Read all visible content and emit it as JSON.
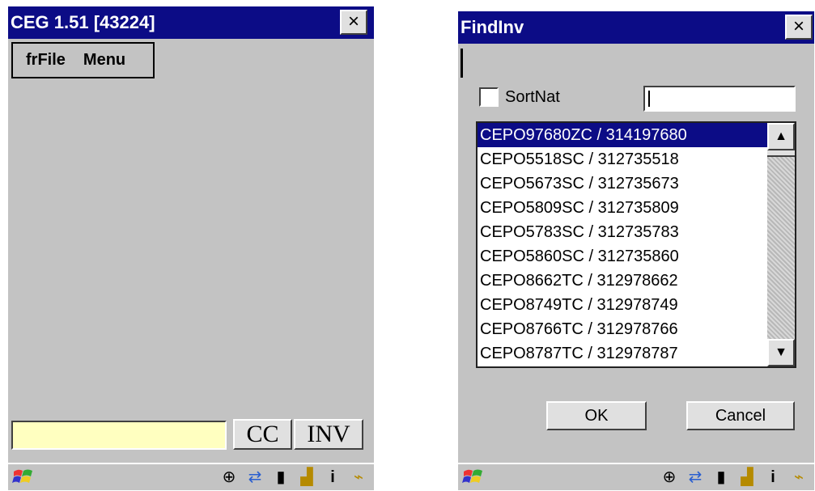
{
  "left_window": {
    "title": "CEG 1.51 [43224]",
    "close_label": "×",
    "menu": [
      "frFile",
      "Menu"
    ],
    "input_value": "",
    "buttons": {
      "cc": "CC",
      "inv": "INV"
    }
  },
  "right_window": {
    "title": "FindInv",
    "close_label": "×",
    "top_input_value": "",
    "checkbox_label": "SortNat",
    "checkbox_checked": false,
    "search_value": "",
    "list_items": [
      "CEPO97680ZC / 314197680",
      "CEPO5518SC / 312735518",
      "CEPO5673SC / 312735673",
      "CEPO5809SC / 312735809",
      "CEPO5783SC / 312735783",
      "CEPO5860SC / 312735860",
      "CEPO8662TC / 312978662",
      "CEPO8749TC / 312978749",
      "CEPO8766TC / 312978766",
      "CEPO8787TC / 312978787"
    ],
    "selected_index": 0,
    "ok_label": "OK",
    "cancel_label": "Cancel"
  },
  "taskbar": {
    "tray_icons": [
      "network-icon",
      "sync-icon",
      "card-icon",
      "battery-icon",
      "info-icon",
      "power-plug-icon"
    ]
  },
  "colors": {
    "titlebar": "#0c0c86",
    "selection": "#0c0c86",
    "input_yellow": "#ffffc0"
  }
}
